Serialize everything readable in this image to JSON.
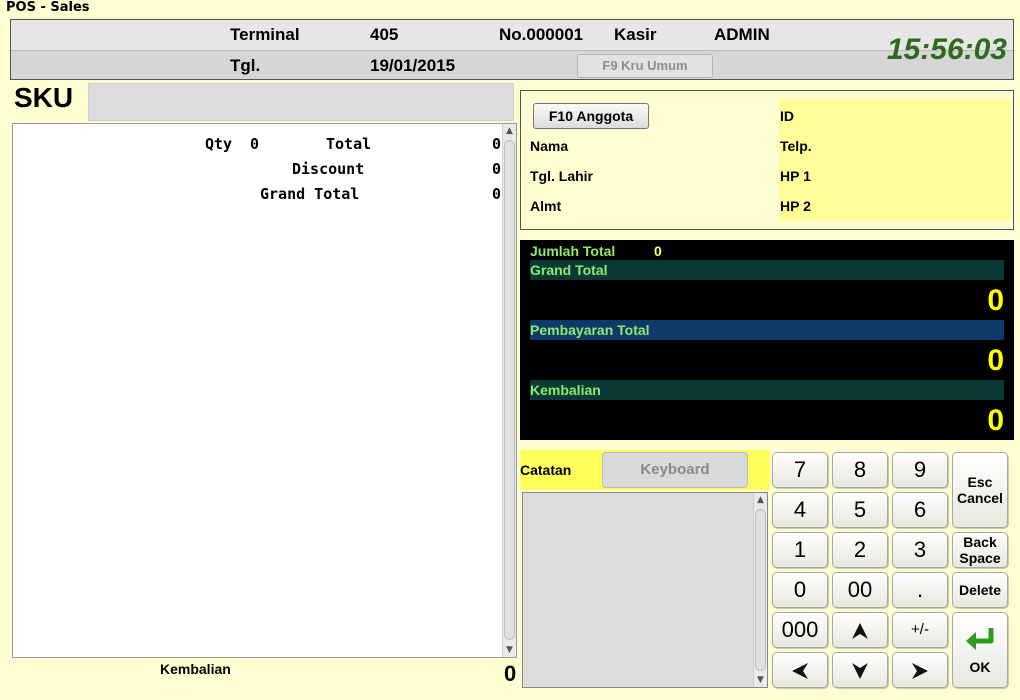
{
  "window": {
    "title": "POS - Sales"
  },
  "header": {
    "terminal_label": "Terminal",
    "terminal_value": "405",
    "number": "No.000001",
    "kasir_label": "Kasir",
    "kasir_value": "ADMIN",
    "date_label": "Tgl.",
    "date_value": "19/01/2015",
    "f9_button": "F9 Kru Umum",
    "clock": "15:56:03"
  },
  "sku": {
    "label": "SKU",
    "value": ""
  },
  "item_list": {
    "qty_label": "Qty",
    "qty_value": "0",
    "total_label": "Total",
    "total_value": "0",
    "discount_label": "Discount",
    "discount_value": "0",
    "grand_total_label": "Grand Total",
    "grand_total_value": "0"
  },
  "footer": {
    "kembalian_label": "Kembalian",
    "kembalian_value": "0"
  },
  "member": {
    "f10_button": "F10 Anggota",
    "nama": "Nama",
    "tgl_lahir": "Tgl. Lahir",
    "almt": "Almt",
    "id": "ID",
    "telp": "Telp.",
    "hp1": "HP 1",
    "hp2": "HP 2"
  },
  "totals": {
    "jumlah_total_label": "Jumlah Total",
    "jumlah_total_value": "0",
    "grand_total_label": "Grand Total",
    "grand_total_value": "0",
    "pembayaran_label": "Pembayaran Total",
    "pembayaran_value": "0",
    "kembalian_label": "Kembalian",
    "kembalian_value": "0"
  },
  "notes": {
    "catatan_label": "Catatan",
    "keyboard_button": "Keyboard"
  },
  "keypad": {
    "k7": "7",
    "k8": "8",
    "k9": "9",
    "k4": "4",
    "k5": "5",
    "k6": "6",
    "k1": "1",
    "k2": "2",
    "k3": "3",
    "k0": "0",
    "k00": "00",
    "kdot": ".",
    "k000": "000",
    "kplusminus": "+/-",
    "esc": "Esc",
    "cancel": "Cancel",
    "back": "Back",
    "space": "Space",
    "delete": "Delete",
    "ok": "OK"
  },
  "colors": {
    "background": "#fffed2",
    "clock": "#2e6b1e",
    "total_label_green": "#8fe96a",
    "total_value_yellow": "#ffff00",
    "band_teal": "#0b3a36",
    "band_blue": "#0e3a6a",
    "member_highlight": "#ffff9a",
    "catatan_highlight": "#ffff5a"
  }
}
